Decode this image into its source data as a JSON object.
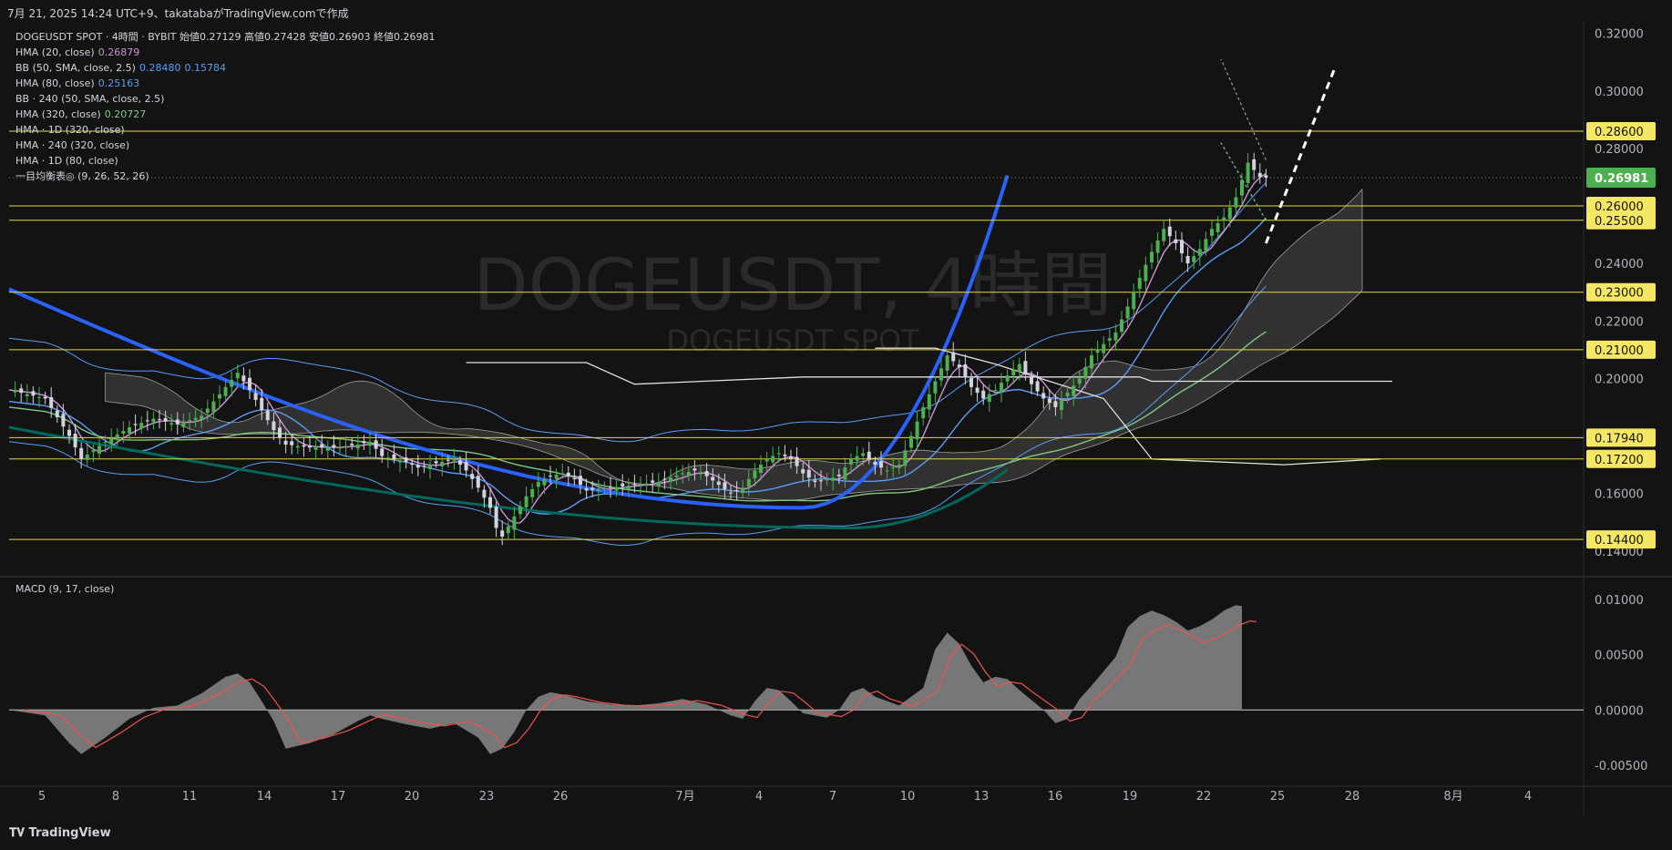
{
  "header": {
    "snapshot_text": "7月 21, 2025 14:24 UTC+9、takatabaがTradingView.comで作成"
  },
  "watermark": {
    "big": "DOGEUSDT, 4時間",
    "small": "DOGEUSDT SPOT"
  },
  "legend": {
    "symbol": "DOGEUSDT SPOT · 4時間 · BYBIT",
    "ohlc": [
      {
        "label": "始値",
        "value": "0.27129"
      },
      {
        "label": "高値",
        "value": "0.27428"
      },
      {
        "label": "安値",
        "value": "0.26903"
      },
      {
        "label": "終値",
        "value": "0.26981"
      }
    ],
    "indicators": [
      {
        "name": "HMA (20, close)",
        "values": [
          "0.26879"
        ],
        "colors": [
          "#ce93d8"
        ]
      },
      {
        "name": "BB (50, SMA, close, 2.5)",
        "values": [
          "0.28480",
          "0.15784"
        ],
        "colors": [
          "#5b9cf6",
          "#5b9cf6"
        ]
      },
      {
        "name": "HMA (80, close)",
        "values": [
          "0.25163"
        ],
        "colors": [
          "#5b9cf6"
        ]
      },
      {
        "name": "BB · 240 (50, SMA, close, 2.5)",
        "values": [],
        "colors": []
      },
      {
        "name": "HMA (320, close)",
        "values": [
          "0.20727"
        ],
        "colors": [
          "#81c784"
        ]
      },
      {
        "name": "HMA · 1D (320, close)",
        "values": [],
        "colors": []
      },
      {
        "name": "HMA · 240 (320, close)",
        "values": [],
        "colors": []
      },
      {
        "name": "HMA · 1D (80, close)",
        "values": [],
        "colors": []
      },
      {
        "name": "一目均衡表◎ (9, 26, 52, 26)",
        "values": [],
        "colors": []
      }
    ],
    "macd_label": "MACD (9, 17, close)"
  },
  "footer": {
    "brand": "TradingView"
  },
  "colors": {
    "background": "#131313",
    "grid": "#1e1e1e",
    "hline": "#e6d44a",
    "up": "#26a69a",
    "down": "#ef5350",
    "candle_up": "#4caf50",
    "candle_down": "#d1d4dc",
    "hma20": "#ce93d8",
    "hma80": "#5b9cf6",
    "hma_daily": "#2962ff",
    "hma320": "#81c784",
    "hma_teal": "#00695c",
    "kumo": "#6b6b6b",
    "macd_hist": "#8a8a8a",
    "macd_signal": "#ef5350",
    "macd_line": "#26a69a"
  },
  "chart_data": {
    "type": "candlestick",
    "symbol": "DOGEUSDT",
    "timeframe": "4時間",
    "x_tick_labels": [
      "5",
      "8",
      "11",
      "14",
      "17",
      "20",
      "23",
      "26",
      "7月",
      "4",
      "7",
      "10",
      "13",
      "16",
      "19",
      "22",
      "25",
      "28",
      "8月",
      "4"
    ],
    "y_axis": {
      "ylim": [
        0.132,
        0.324
      ],
      "ticks": [
        "0.32000",
        "0.30000",
        "0.28000",
        "0.26000",
        "0.24000",
        "0.22000",
        "0.20000",
        "0.18000",
        "0.16000",
        "0.14000"
      ]
    },
    "horizontal_levels": [
      "0.28600",
      "0.26000",
      "0.25500",
      "0.23000",
      "0.21000",
      "0.17940",
      "0.17200",
      "0.14400"
    ],
    "current_price": "0.26981",
    "price_path": [
      [
        0,
        0.196
      ],
      [
        3,
        0.193
      ],
      [
        5,
        0.18
      ],
      [
        6,
        0.172
      ],
      [
        8,
        0.178
      ],
      [
        10,
        0.183
      ],
      [
        12,
        0.186
      ],
      [
        14,
        0.184
      ],
      [
        16,
        0.187
      ],
      [
        17,
        0.192
      ],
      [
        18,
        0.197
      ],
      [
        19,
        0.202
      ],
      [
        20,
        0.196
      ],
      [
        21,
        0.189
      ],
      [
        22,
        0.182
      ],
      [
        23,
        0.177
      ],
      [
        25,
        0.176
      ],
      [
        27,
        0.176
      ],
      [
        29,
        0.177
      ],
      [
        30,
        0.178
      ],
      [
        31,
        0.173
      ],
      [
        33,
        0.171
      ],
      [
        34,
        0.169
      ],
      [
        35,
        0.17
      ],
      [
        36,
        0.171
      ],
      [
        37,
        0.172
      ],
      [
        38,
        0.168
      ],
      [
        39,
        0.162
      ],
      [
        40,
        0.155
      ],
      [
        40.5,
        0.148
      ],
      [
        41,
        0.145
      ],
      [
        42,
        0.152
      ],
      [
        43,
        0.159
      ],
      [
        44,
        0.164
      ],
      [
        45,
        0.166
      ],
      [
        46,
        0.167
      ],
      [
        47,
        0.165
      ],
      [
        48,
        0.161
      ],
      [
        50,
        0.162
      ],
      [
        52,
        0.163
      ],
      [
        54,
        0.164
      ],
      [
        56,
        0.167
      ],
      [
        57,
        0.168
      ],
      [
        58,
        0.166
      ],
      [
        59,
        0.163
      ],
      [
        60,
        0.16
      ],
      [
        61,
        0.162
      ],
      [
        62,
        0.168
      ],
      [
        63,
        0.172
      ],
      [
        64,
        0.174
      ],
      [
        65,
        0.172
      ],
      [
        66,
        0.167
      ],
      [
        67,
        0.164
      ],
      [
        69,
        0.166
      ],
      [
        70,
        0.172
      ],
      [
        71,
        0.174
      ],
      [
        72,
        0.17
      ],
      [
        73,
        0.168
      ],
      [
        74,
        0.17
      ],
      [
        75,
        0.18
      ],
      [
        76,
        0.19
      ],
      [
        77,
        0.199
      ],
      [
        78,
        0.208
      ],
      [
        79,
        0.204
      ],
      [
        80,
        0.197
      ],
      [
        81,
        0.193
      ],
      [
        82,
        0.196
      ],
      [
        83,
        0.201
      ],
      [
        84,
        0.205
      ],
      [
        85,
        0.198
      ],
      [
        86,
        0.193
      ],
      [
        87,
        0.19
      ],
      [
        88,
        0.195
      ],
      [
        89,
        0.2
      ],
      [
        90,
        0.208
      ],
      [
        91,
        0.212
      ],
      [
        92,
        0.216
      ],
      [
        93,
        0.225
      ],
      [
        94,
        0.235
      ],
      [
        95,
        0.244
      ],
      [
        96,
        0.252
      ],
      [
        97,
        0.247
      ],
      [
        98,
        0.24
      ],
      [
        99,
        0.245
      ],
      [
        100,
        0.252
      ],
      [
        101,
        0.256
      ],
      [
        102,
        0.263
      ],
      [
        103,
        0.275
      ],
      [
        104,
        0.27
      ],
      [
        104.5,
        0.26981
      ]
    ],
    "macd": {
      "ylim": [
        -0.0065,
        0.0115
      ],
      "ticks": [
        "0.01000",
        "0.00500",
        "0.00000",
        "-0.00500"
      ],
      "histogram_path": [
        [
          0,
          0.0
        ],
        [
          3,
          -0.0005
        ],
        [
          5,
          -0.003
        ],
        [
          6,
          -0.004
        ],
        [
          8,
          -0.0025
        ],
        [
          10,
          -0.0008
        ],
        [
          12,
          0.0002
        ],
        [
          14,
          0.0004
        ],
        [
          16,
          0.0015
        ],
        [
          18,
          0.003
        ],
        [
          19,
          0.0033
        ],
        [
          20,
          0.0025
        ],
        [
          21,
          0.0008
        ],
        [
          22,
          -0.001
        ],
        [
          23,
          -0.0035
        ],
        [
          25,
          -0.003
        ],
        [
          27,
          -0.0022
        ],
        [
          29,
          -0.001
        ],
        [
          30,
          -0.0005
        ],
        [
          31,
          -0.0008
        ],
        [
          33,
          -0.0013
        ],
        [
          35,
          -0.0017
        ],
        [
          37,
          -0.0012
        ],
        [
          39,
          -0.0025
        ],
        [
          40,
          -0.004
        ],
        [
          41,
          -0.0035
        ],
        [
          42,
          -0.002
        ],
        [
          43,
          0.0
        ],
        [
          44,
          0.0012
        ],
        [
          45,
          0.0016
        ],
        [
          46,
          0.0014
        ],
        [
          48,
          0.0008
        ],
        [
          50,
          0.0005
        ],
        [
          52,
          0.0004
        ],
        [
          54,
          0.0006
        ],
        [
          56,
          0.001
        ],
        [
          58,
          0.0005
        ],
        [
          60,
          -0.0005
        ],
        [
          61,
          -0.0008
        ],
        [
          62,
          0.0008
        ],
        [
          63,
          0.002
        ],
        [
          64,
          0.0018
        ],
        [
          65,
          0.0008
        ],
        [
          66,
          -0.0003
        ],
        [
          68,
          -0.0007
        ],
        [
          69,
          0.0
        ],
        [
          70,
          0.0016
        ],
        [
          71,
          0.002
        ],
        [
          72,
          0.0012
        ],
        [
          74,
          0.0004
        ],
        [
          76,
          0.002
        ],
        [
          77,
          0.0055
        ],
        [
          78,
          0.007
        ],
        [
          79,
          0.006
        ],
        [
          80,
          0.004
        ],
        [
          81,
          0.0025
        ],
        [
          82,
          0.003
        ],
        [
          83,
          0.0028
        ],
        [
          84,
          0.0018
        ],
        [
          86,
          0.0
        ],
        [
          87,
          -0.0012
        ],
        [
          88,
          -0.0008
        ],
        [
          89,
          0.001
        ],
        [
          90,
          0.0022
        ],
        [
          91,
          0.0035
        ],
        [
          92,
          0.0048
        ],
        [
          93,
          0.0075
        ],
        [
          94,
          0.0085
        ],
        [
          95,
          0.009
        ],
        [
          96,
          0.0086
        ],
        [
          97,
          0.008
        ],
        [
          98,
          0.0072
        ],
        [
          99,
          0.0076
        ],
        [
          100,
          0.0082
        ],
        [
          101,
          0.009
        ],
        [
          102,
          0.0095
        ],
        [
          102.5,
          0.0094
        ]
      ]
    }
  }
}
